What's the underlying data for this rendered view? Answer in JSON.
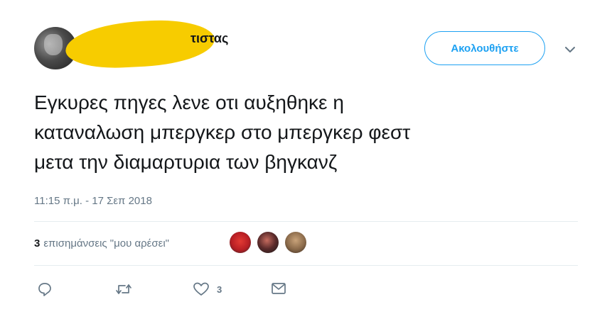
{
  "header": {
    "name_visible": "τιστας",
    "follow_label": "Ακολουθήστε",
    "avatar_icon": "avatar-icon",
    "caret_icon": "chevron-down-icon"
  },
  "tweet": {
    "lines": [
      "Εγκυρες πηγες λενε οτι αυξηθηκε η",
      "καταναλωση μπεργκερ στο μπεργκερ φεστ",
      "μετα την διαμαρτυρια των βηγκανζ"
    ],
    "timestamp": "11:15 π.μ. - 17 Σεπ 2018"
  },
  "likes": {
    "count": "3",
    "label": "επισημάνσεις \"μου αρέσει\"",
    "avatars": [
      "liker-avatar-1",
      "liker-avatar-2",
      "liker-avatar-3"
    ]
  },
  "actions": {
    "reply_icon": "reply-icon",
    "retweet_icon": "retweet-icon",
    "like_icon": "heart-icon",
    "like_count": "3",
    "dm_icon": "envelope-icon"
  },
  "colors": {
    "accent": "#1da1f2",
    "secondary_text": "#657786",
    "redaction": "#f7cc00"
  }
}
